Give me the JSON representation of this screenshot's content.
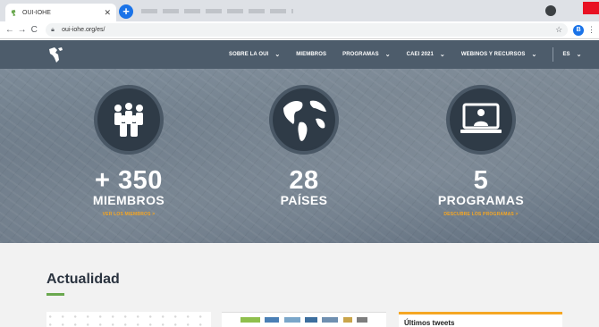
{
  "browser": {
    "tab_title": "OUI-IOHE",
    "url": "oui-iohe.org/es/",
    "profile_initial": "B"
  },
  "nav": {
    "items": [
      {
        "label": "SOBRE LA OUI",
        "has_dropdown": true
      },
      {
        "label": "MIEMBROS",
        "has_dropdown": false
      },
      {
        "label": "PROGRAMAS",
        "has_dropdown": true
      },
      {
        "label": "CAEI 2021",
        "has_dropdown": true
      },
      {
        "label": "WEBINOS Y RECURSOS",
        "has_dropdown": true
      },
      {
        "label": "ES",
        "has_dropdown": true
      }
    ]
  },
  "stats": [
    {
      "number": "+ 350",
      "label": "MIEMBROS",
      "link": "VER LOS MIEMBROS >",
      "icon": "people-icon"
    },
    {
      "number": "28",
      "label": "PAÍSES",
      "link": "",
      "icon": "globe-icon"
    },
    {
      "number": "5",
      "label": "PROGRAMAS",
      "link": "DESCUBRE LOS PROGRAMAS >",
      "icon": "monitor-person-icon"
    }
  ],
  "news": {
    "title": "Actualidad",
    "tweets_title": "Últimos tweets"
  },
  "colors": {
    "nav_bg": "#4d5c6b",
    "accent_orange": "#f5a623",
    "accent_green": "#6aa84f",
    "icon_circle": "#2f3b47"
  }
}
